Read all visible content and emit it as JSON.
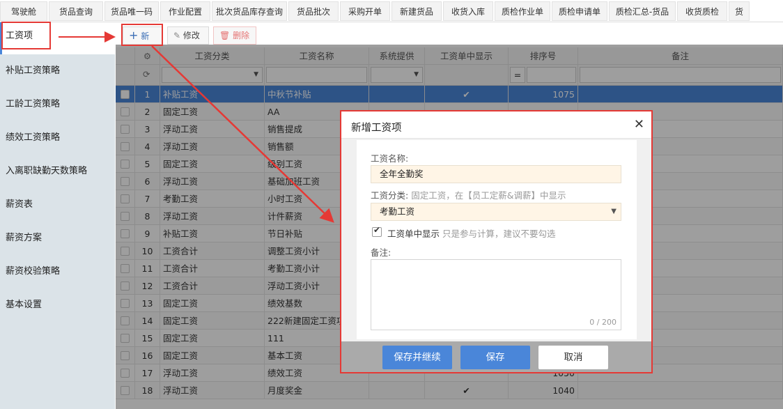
{
  "top_tabs": [
    "驾驶舱",
    "货品查询",
    "货品唯一码",
    "作业配置",
    "批次货品库存查询",
    "货品批次",
    "采购开单",
    "新建货品",
    "收货入库",
    "质检作业单",
    "质检申请单",
    "质检汇总-货品",
    "收货质检",
    "货"
  ],
  "sidebar": {
    "items": [
      "工资项",
      "补贴工资策略",
      "工龄工资策略",
      "绩效工资策略",
      "入离职缺勤天数策略",
      "薪资表",
      "薪资方案",
      "薪资校验策略",
      "基本设置"
    ],
    "active_index": 0
  },
  "toolbar": {
    "add_label": "新增",
    "edit_label": "修改",
    "delete_label": "删除"
  },
  "table": {
    "columns": [
      "工资分类",
      "工资名称",
      "系统提供",
      "工资单中显示",
      "排序号",
      "备注"
    ],
    "sort_filter_symbol": "=",
    "rows": [
      {
        "n": "1",
        "cat": "补贴工资",
        "name": "中秋节补贴",
        "show": "✔",
        "order": "1075"
      },
      {
        "n": "2",
        "cat": "固定工资",
        "name": "AA",
        "show": "",
        "order": ""
      },
      {
        "n": "3",
        "cat": "浮动工资",
        "name": "销售提成",
        "show": "",
        "order": ""
      },
      {
        "n": "4",
        "cat": "浮动工资",
        "name": "销售额",
        "show": "",
        "order": ""
      },
      {
        "n": "5",
        "cat": "固定工资",
        "name": "级别工资",
        "show": "",
        "order": ""
      },
      {
        "n": "6",
        "cat": "浮动工资",
        "name": "基础加班工资",
        "show": "",
        "order": ""
      },
      {
        "n": "7",
        "cat": "考勤工资",
        "name": "小时工资",
        "show": "",
        "order": ""
      },
      {
        "n": "8",
        "cat": "浮动工资",
        "name": "计件薪资",
        "show": "",
        "order": ""
      },
      {
        "n": "9",
        "cat": "补贴工资",
        "name": "节日补贴",
        "show": "",
        "order": ""
      },
      {
        "n": "10",
        "cat": "工资合计",
        "name": "调整工资小计",
        "show": "",
        "order": ""
      },
      {
        "n": "11",
        "cat": "工资合计",
        "name": "考勤工资小计",
        "show": "",
        "order": ""
      },
      {
        "n": "12",
        "cat": "工资合计",
        "name": "浮动工资小计",
        "show": "",
        "order": ""
      },
      {
        "n": "13",
        "cat": "固定工资",
        "name": "绩效基数",
        "show": "",
        "order": ""
      },
      {
        "n": "14",
        "cat": "固定工资",
        "name": "222新建固定工资项",
        "show": "",
        "order": ""
      },
      {
        "n": "15",
        "cat": "固定工资",
        "name": "111",
        "show": "",
        "order": ""
      },
      {
        "n": "16",
        "cat": "固定工资",
        "name": "基本工资",
        "show": "",
        "order": ""
      },
      {
        "n": "17",
        "cat": "浮动工资",
        "name": "绩效工资",
        "show": "",
        "order": "1050"
      },
      {
        "n": "18",
        "cat": "浮动工资",
        "name": "月度奖金",
        "show": "✔",
        "order": "1040"
      }
    ]
  },
  "dialog": {
    "title": "新增工资项",
    "name_label": "工资名称:",
    "name_value": "全年全勤奖",
    "category_label": "工资分类:",
    "category_hint": "固定工资，在【员工定薪&调薪】中显示",
    "category_value": "考勤工资",
    "show_label": "工资单中显示",
    "show_hint": "只是参与计算，建议不要勾选",
    "remark_label": "备注:",
    "remark_counter": "0 / 200",
    "btn_save_continue": "保存并继续",
    "btn_save": "保存",
    "btn_cancel": "取消"
  },
  "colors": {
    "accent": "#4a86d9",
    "selected_row": "#4a86d9",
    "annotation_red": "#e53935",
    "field_bg": "#fff5e6"
  }
}
